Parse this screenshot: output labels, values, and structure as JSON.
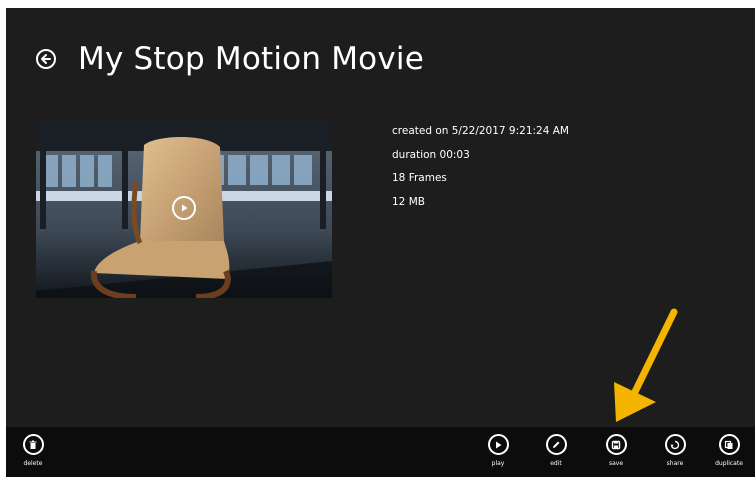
{
  "header": {
    "title": "My Stop Motion Movie"
  },
  "details": {
    "created": "created on 5/22/2017 9:21:24 AM",
    "duration": "duration 00:03",
    "frames": "18 Frames",
    "size": "12 MB"
  },
  "appbar": {
    "delete_label": "delete",
    "play_label": "play",
    "edit_label": "edit",
    "save_label": "save",
    "share_label": "share",
    "duplicate_label": "duplicate"
  },
  "colors": {
    "background": "#1d1d1d",
    "appbar": "#0c0c0c",
    "foreground": "#ffffff",
    "annotation_arrow": "#f5b400"
  },
  "icons": [
    "back-arrow-icon",
    "play-icon",
    "trash-icon",
    "pencil-icon",
    "floppy-disk-icon",
    "share-cycle-icon",
    "copy-icon"
  ]
}
